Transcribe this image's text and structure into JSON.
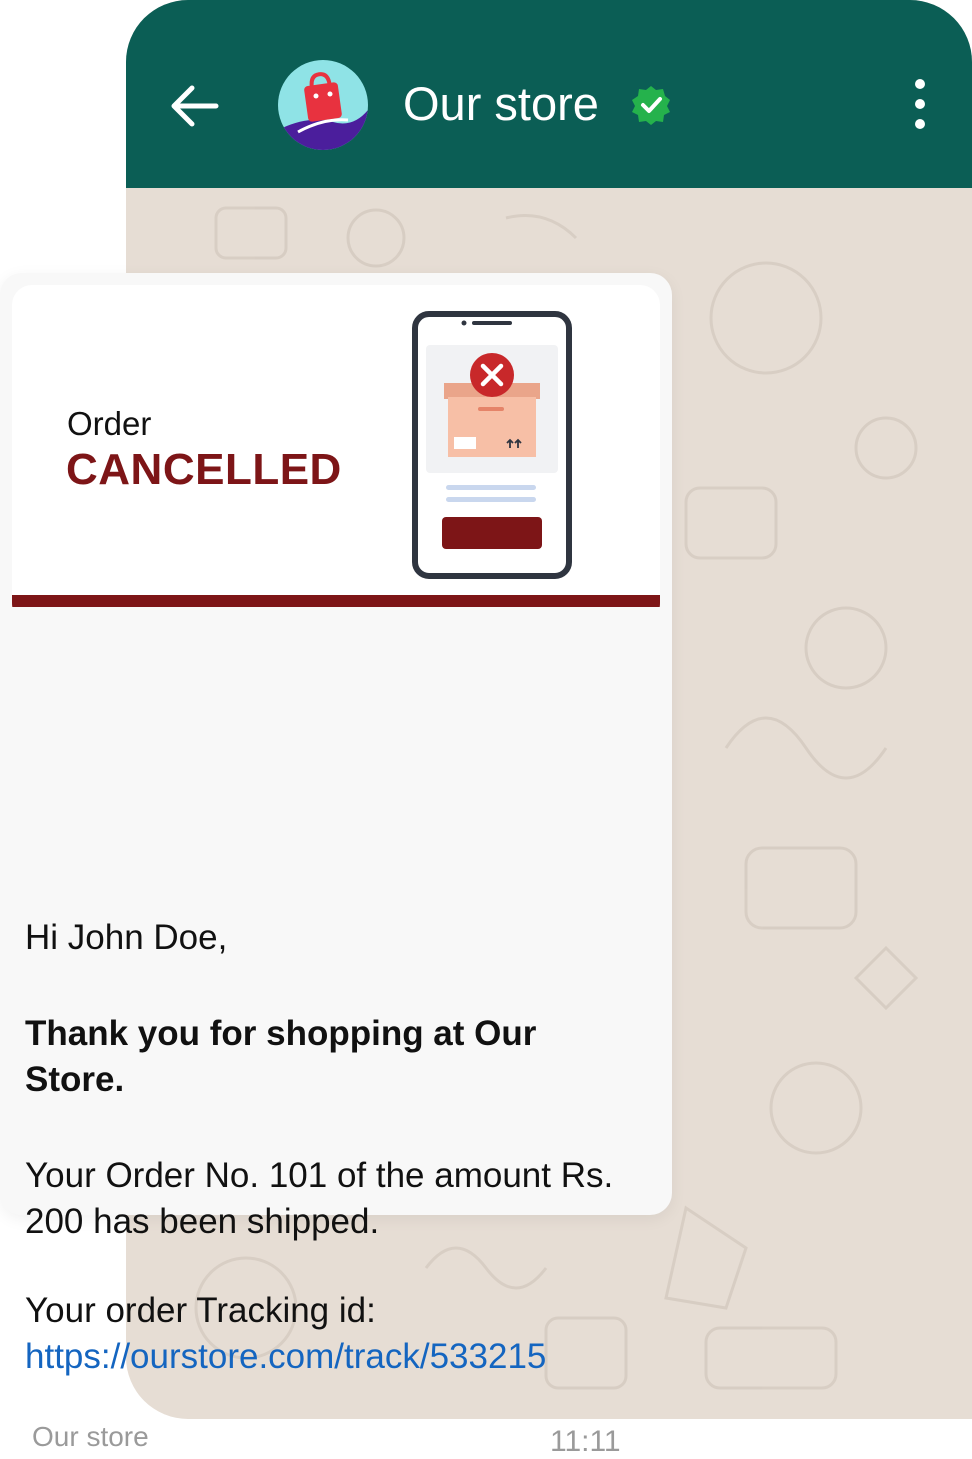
{
  "header": {
    "title": "Our store",
    "back_icon": "arrow-left-icon",
    "menu_icon": "more-vertical-icon",
    "verified_icon": "verified-badge-icon",
    "color": "#0b5e55"
  },
  "banner": {
    "line1": "Order",
    "line2": "CANCELLED",
    "illustration": "phone-cancelled-box-icon",
    "accent_color": "#7d1517"
  },
  "message": {
    "greeting": "Hi John Doe,",
    "thanks": "Thank you for shopping at Our Store.",
    "order_text": "Your Order No. 101 of the amount Rs. 200 has been shipped.",
    "tracking_label": "Your order Tracking id:",
    "tracking_link": "https://ourstore.com/track/533215",
    "sender": "Our store",
    "time": "11:11"
  },
  "colors": {
    "link": "#1465c0",
    "chat_background": "#e6ddd4"
  }
}
